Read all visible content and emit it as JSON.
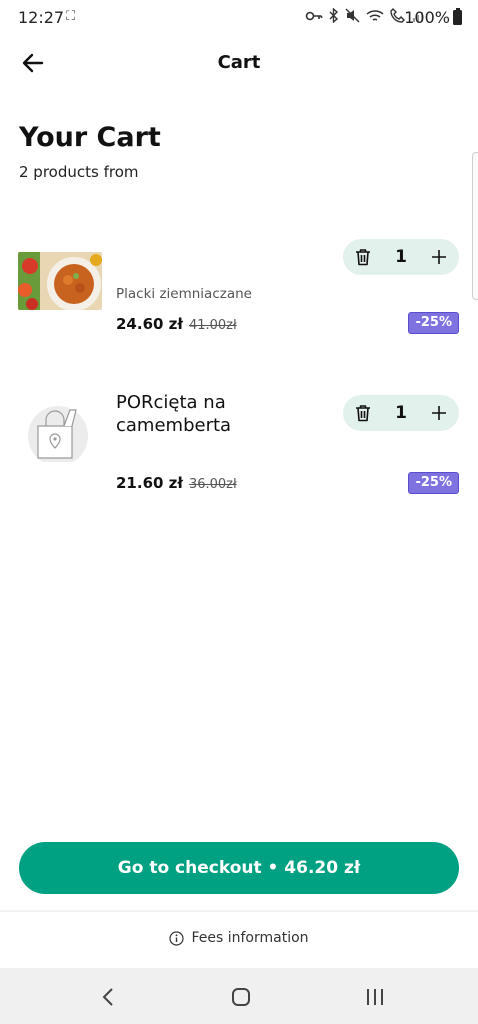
{
  "status": {
    "time": "12:27",
    "extra": "⛶",
    "battery": "100%"
  },
  "header": {
    "title": "Cart"
  },
  "page": {
    "title": "Your Cart",
    "subtitle": "2 products from"
  },
  "items": [
    {
      "name": "Placki ziemniaczane",
      "quantity": "1",
      "price": "24.60 zł",
      "old_price": "41.00zł",
      "discount": "-25%"
    },
    {
      "name": " PORcięta na\ncamemberta",
      "quantity": "1",
      "price": "21.60 zł",
      "old_price": "36.00zł",
      "discount": "-25%"
    }
  ],
  "checkout": {
    "label": "Go to checkout • 46.20 zł"
  },
  "fees": {
    "label": "Fees information"
  },
  "colors": {
    "accent": "#00a082",
    "qty_bg": "#e3f1ec",
    "discount": "#7e72e0"
  }
}
